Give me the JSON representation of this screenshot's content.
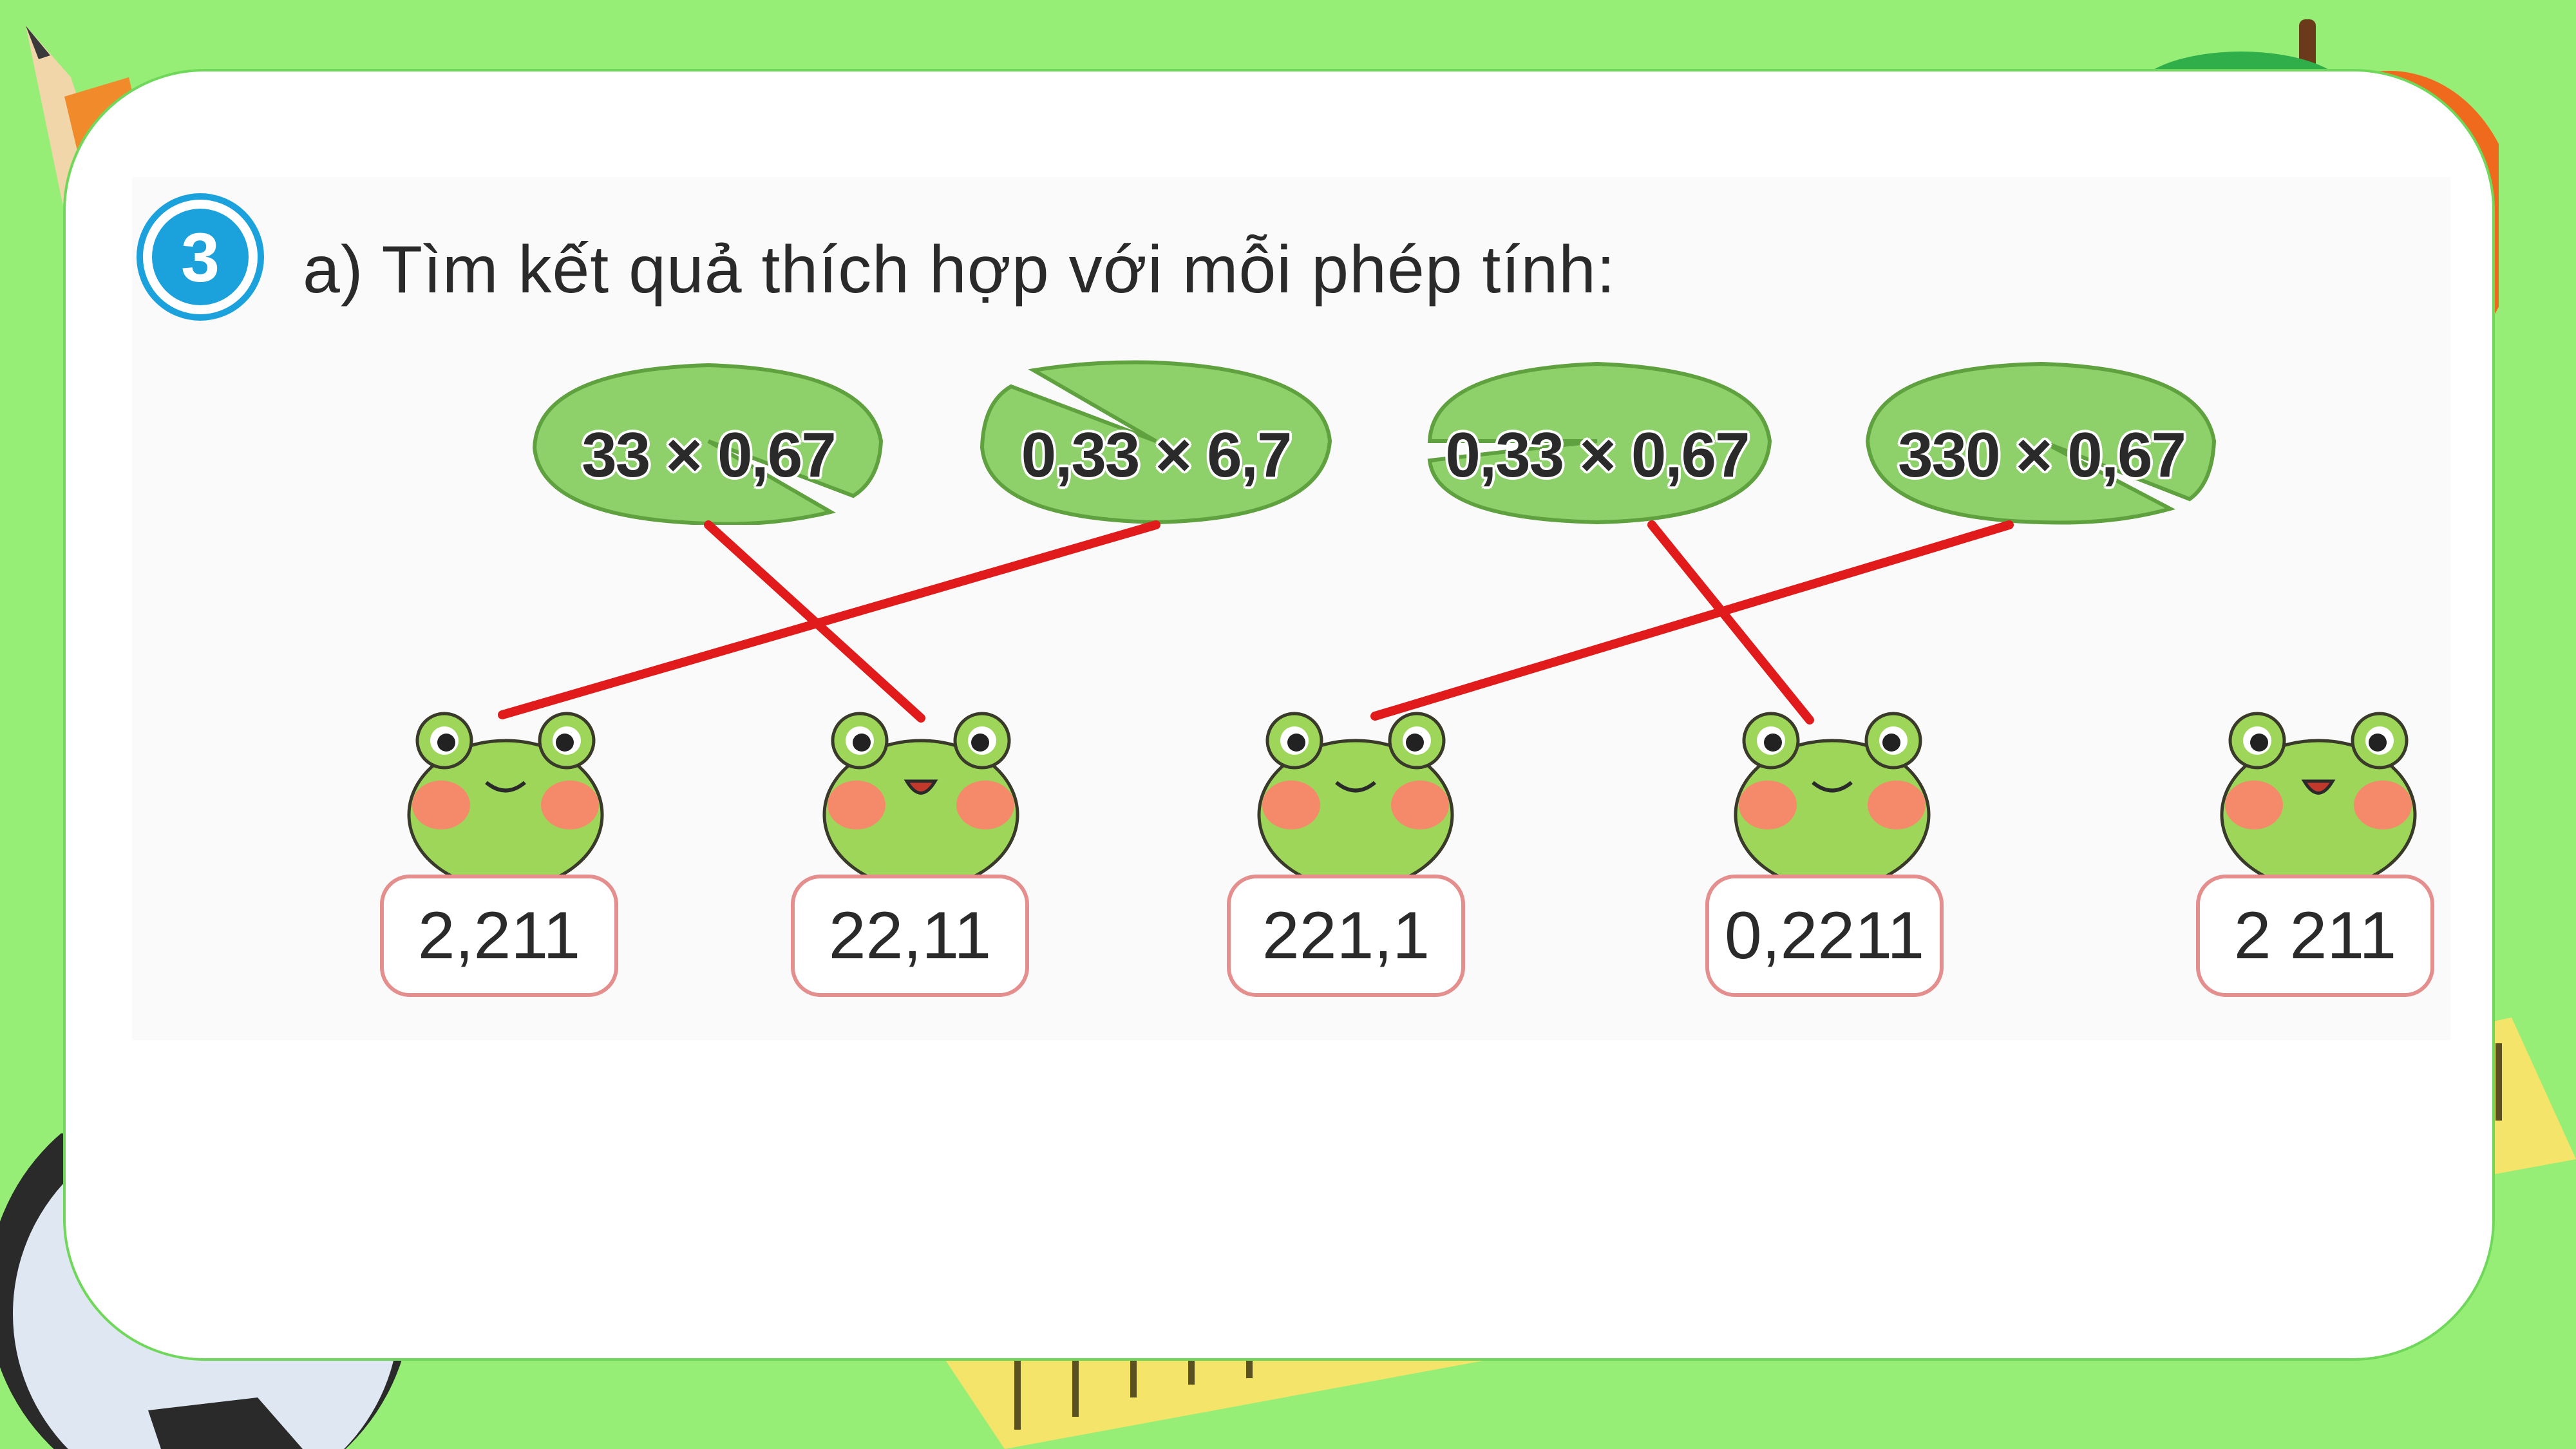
{
  "exercise": {
    "number": "3",
    "prompt": "a) Tìm kết quả thích hợp với mỗi phép tính:"
  },
  "expressions": [
    {
      "text": "33 × 0,67"
    },
    {
      "text": "0,33 × 6,7"
    },
    {
      "text": "0,33 × 0,67"
    },
    {
      "text": "330 × 0,67"
    }
  ],
  "answers": [
    {
      "text": "2,211"
    },
    {
      "text": "22,11"
    },
    {
      "text": "221,1"
    },
    {
      "text": "0,2211"
    },
    {
      "text": "2 211"
    }
  ],
  "matches": [
    {
      "expression": "33 × 0,67",
      "answer": "22,11"
    },
    {
      "expression": "0,33 × 6,7",
      "answer": "2,211"
    },
    {
      "expression": "0,33 × 0,67",
      "answer": "0,2211"
    },
    {
      "expression": "330 × 0,67",
      "answer": "221,1"
    }
  ],
  "colors": {
    "background": "#97ee76",
    "badge": "#1ba1dc",
    "leaf": "#8ed06a",
    "frog": "#9ed65a",
    "cheek": "#f58a6a",
    "answer_border": "#e58e8e",
    "match_line": "#e11b1b"
  }
}
